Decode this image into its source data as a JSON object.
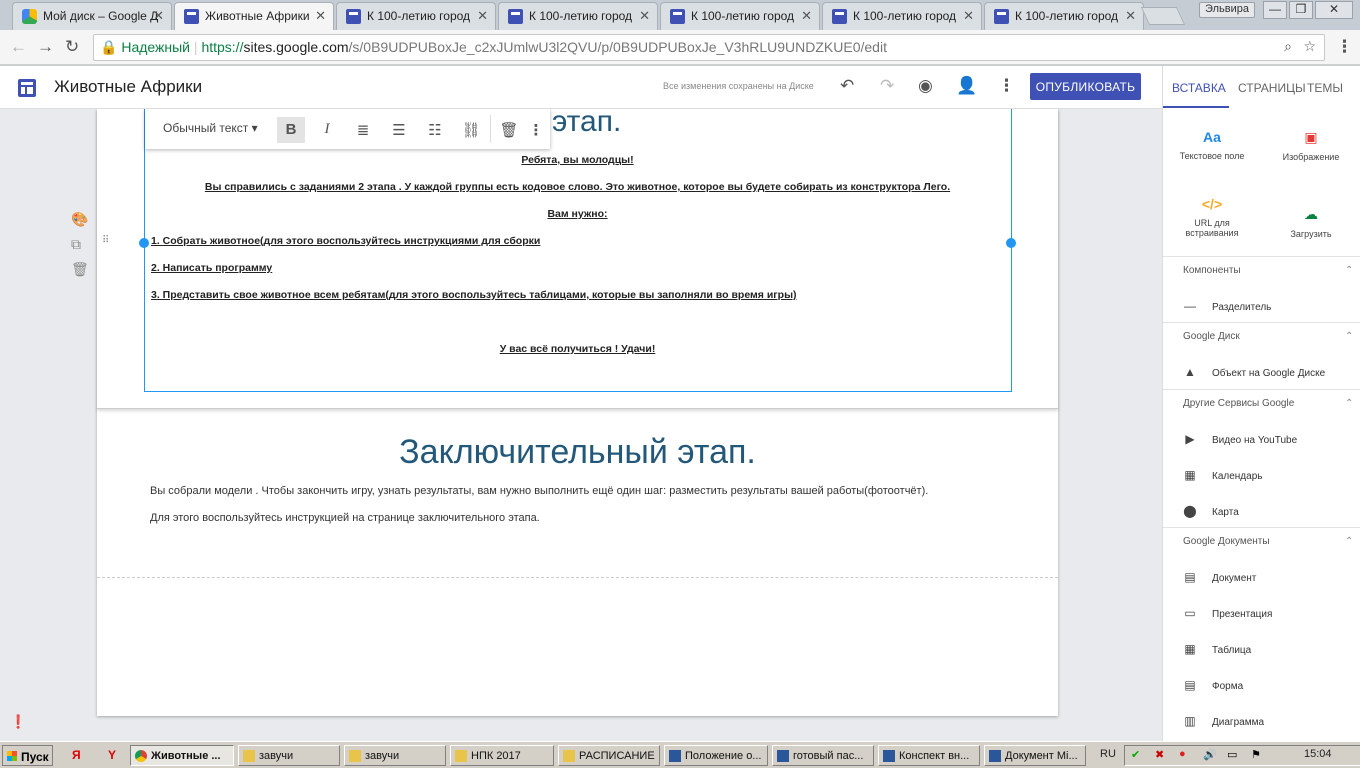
{
  "browser": {
    "tabs": [
      {
        "title": "Мой диск – Google Д",
        "type": "drive"
      },
      {
        "title": "Животные Африки",
        "type": "sites",
        "active": true
      },
      {
        "title": "К 100-летию город",
        "type": "sites"
      },
      {
        "title": "К 100-летию город",
        "type": "sites"
      },
      {
        "title": "К 100-летию город",
        "type": "sites"
      },
      {
        "title": "К 100-летию город",
        "type": "sites"
      },
      {
        "title": "К 100-летию город",
        "type": "sites"
      }
    ],
    "user_name": "Эльвира",
    "security_label": "Надежный",
    "url_scheme": "https://",
    "url_host": "sites.google.com",
    "url_path": "/s/0B9UDPUBoxJe_c2xJUmlwU3l2QVU/p/0B9UDPUBoxJe_V3hRLU9UNDZKUE0/edit"
  },
  "header": {
    "site_title": "Животные Африки",
    "saved_status": "Все изменения сохранены на Диске",
    "publish_label": "ОПУБЛИКОВАТЬ"
  },
  "panel": {
    "tabs": [
      "ВСТАВКА",
      "СТРАНИЦЫ",
      "ТЕМЫ"
    ],
    "insert": {
      "textbox": "Текстовое поле",
      "image": "Изображение",
      "embed": "URL для встраивания",
      "upload": "Загрузить"
    },
    "sections": {
      "components": {
        "title": "Компоненты",
        "items": [
          "Разделитель"
        ]
      },
      "drive": {
        "title": "Google Диск",
        "items": [
          "Объект на Google Диске"
        ]
      },
      "other": {
        "title": "Другие Сервисы Google",
        "items": [
          "Видео на YouTube",
          "Календарь",
          "Карта"
        ]
      },
      "docs": {
        "title": "Google Документы",
        "items": [
          "Документ",
          "Презентация",
          "Таблица",
          "Форма",
          "Диаграмма"
        ]
      }
    }
  },
  "editor": {
    "format_bar": {
      "style_label": "Обычный текст"
    },
    "section1": {
      "heading_tail": "этап.",
      "lines": [
        "Ребята, вы молодцы!",
        "Вы справились с заданиями 2 этапа . У  каждой группы есть кодовое слово. Это животное, которое вы будете собирать из конструктора Лего.",
        "Вам нужно:",
        "1. Собрать животное(для этого воспользуйтесь инструкциями для сборки",
        "2. Написать программу",
        "3. Представить свое животное всем ребятам(для этого воспользуйтесь таблицами, которые вы заполняли во время игры)",
        "У вас всё получиться ! Удачи!"
      ]
    },
    "section2": {
      "heading": "Заключительный этап.",
      "paragraph1": "Вы собрали модели . Чтобы закончить игру, узнать результаты, вам нужно выполнить ещё один шаг: разместить результаты вашей работы(фотоотчёт).",
      "paragraph2": "Для этого воспользуйтесь инструкцией на странице  заключительного этапа."
    }
  },
  "taskbar": {
    "start_label": "Пуск",
    "items": [
      {
        "label": "Животные ...",
        "icon": "chrome",
        "active": true
      },
      {
        "label": "завучи",
        "icon": "folder"
      },
      {
        "label": "завучи",
        "icon": "folder"
      },
      {
        "label": "НПК 2017",
        "icon": "folder"
      },
      {
        "label": "РАСПИСАНИЕ",
        "icon": "folder"
      },
      {
        "label": "Положение о...",
        "icon": "word"
      },
      {
        "label": "готовый пас...",
        "icon": "word"
      },
      {
        "label": "Конспект вн...",
        "icon": "word"
      },
      {
        "label": "Документ Mi...",
        "icon": "word"
      }
    ],
    "lang": "RU",
    "clock": "15:04"
  },
  "colors": {
    "accent": "#3f51b5",
    "heading": "#24587a",
    "selection": "#2196f3",
    "secure": "#0b8043"
  }
}
